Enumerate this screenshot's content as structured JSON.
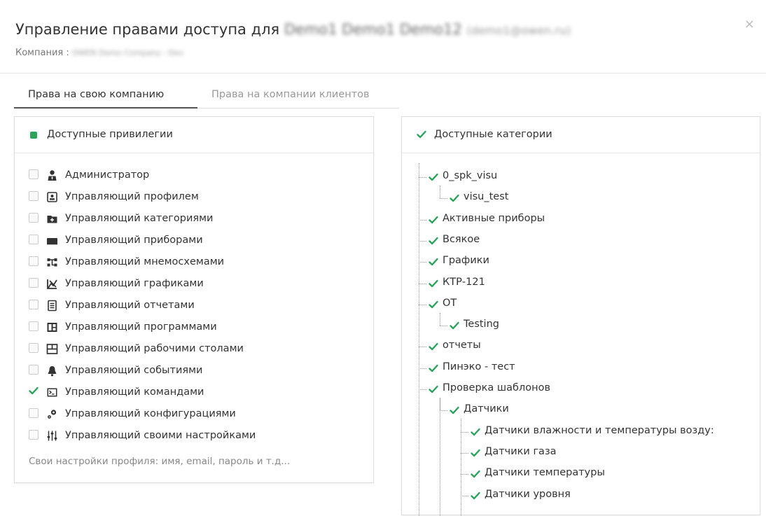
{
  "dialog": {
    "title_prefix": "Управление правами доступа для",
    "title_name": "Demo1 Demo1 Demo12",
    "title_email": "(demo1@owen.ru)",
    "company_label": "Компания :",
    "company_value": "OWEN Demo Company : Dev",
    "close_symbol": "×"
  },
  "tabs": [
    {
      "label": "Права на свою компанию",
      "active": true
    },
    {
      "label": "Права на компании клиентов",
      "active": false
    }
  ],
  "privileges": {
    "header": "Доступные привилегии",
    "items": [
      {
        "label": "Администратор",
        "checked": false,
        "icon": "admin-user-icon"
      },
      {
        "label": "Управляющий профилем",
        "checked": false,
        "icon": "profile-card-icon"
      },
      {
        "label": "Управляющий категориями",
        "checked": false,
        "icon": "folder-plus-icon"
      },
      {
        "label": "Управляющий приборами",
        "checked": false,
        "icon": "device-icon"
      },
      {
        "label": "Управляющий мнемосхемами",
        "checked": false,
        "icon": "mnemonic-scheme-icon"
      },
      {
        "label": "Управляющий графиками",
        "checked": false,
        "icon": "chart-icon"
      },
      {
        "label": "Управляющий отчетами",
        "checked": false,
        "icon": "report-icon"
      },
      {
        "label": "Управляющий программами",
        "checked": false,
        "icon": "program-icon"
      },
      {
        "label": "Управляющий рабочими столами",
        "checked": false,
        "icon": "desktop-icon"
      },
      {
        "label": "Управляющий событиями",
        "checked": false,
        "icon": "bell-icon"
      },
      {
        "label": "Управляющий командами",
        "checked": true,
        "icon": "terminal-icon"
      },
      {
        "label": "Управляющий конфигурациями",
        "checked": false,
        "icon": "gears-icon"
      },
      {
        "label": "Управляющий своими настройками",
        "checked": false,
        "icon": "sliders-icon"
      }
    ],
    "hint": "Свои настройки профиля: имя, email, пароль и т.д..."
  },
  "categories": {
    "header": "Доступные категории",
    "items": [
      {
        "label": "0_spk_visu",
        "level": 0
      },
      {
        "label": "visu_test",
        "level": 1
      },
      {
        "label": "Активные приборы",
        "level": 0
      },
      {
        "label": "Всякое",
        "level": 0
      },
      {
        "label": "Графики",
        "level": 0
      },
      {
        "label": "КТР-121",
        "level": 0
      },
      {
        "label": "ОТ",
        "level": 0
      },
      {
        "label": "Testing",
        "level": 1
      },
      {
        "label": "отчеты",
        "level": 0
      },
      {
        "label": "Пинэко - тест",
        "level": 0
      },
      {
        "label": "Проверка шаблонов",
        "level": 0
      },
      {
        "label": "Датчики",
        "level": 1
      },
      {
        "label": "Датчики влажности и температуры возду:",
        "level": 2
      },
      {
        "label": "Датчики газа",
        "level": 2
      },
      {
        "label": "Датчики температуры",
        "level": 2
      },
      {
        "label": "Датчики уровня",
        "level": 2
      }
    ]
  },
  "colors": {
    "accent_green": "#2aa35b",
    "text": "#333333",
    "muted": "#999999"
  }
}
